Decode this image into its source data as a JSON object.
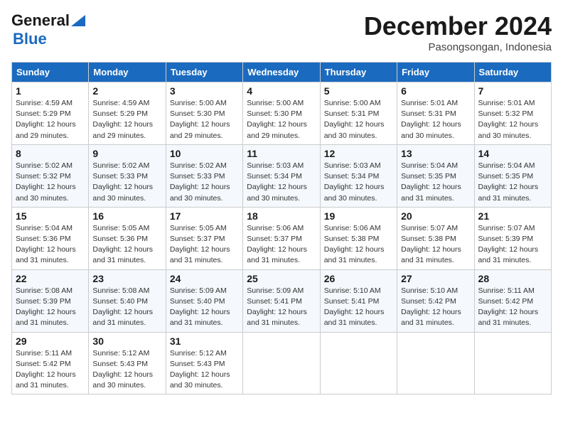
{
  "logo": {
    "text_general": "General",
    "text_blue": "Blue"
  },
  "title": {
    "month_year": "December 2024",
    "location": "Pasongsongan, Indonesia"
  },
  "weekdays": [
    "Sunday",
    "Monday",
    "Tuesday",
    "Wednesday",
    "Thursday",
    "Friday",
    "Saturday"
  ],
  "weeks": [
    [
      {
        "day": "1",
        "info": "Sunrise: 4:59 AM\nSunset: 5:29 PM\nDaylight: 12 hours\nand 29 minutes."
      },
      {
        "day": "2",
        "info": "Sunrise: 4:59 AM\nSunset: 5:29 PM\nDaylight: 12 hours\nand 29 minutes."
      },
      {
        "day": "3",
        "info": "Sunrise: 5:00 AM\nSunset: 5:30 PM\nDaylight: 12 hours\nand 29 minutes."
      },
      {
        "day": "4",
        "info": "Sunrise: 5:00 AM\nSunset: 5:30 PM\nDaylight: 12 hours\nand 29 minutes."
      },
      {
        "day": "5",
        "info": "Sunrise: 5:00 AM\nSunset: 5:31 PM\nDaylight: 12 hours\nand 30 minutes."
      },
      {
        "day": "6",
        "info": "Sunrise: 5:01 AM\nSunset: 5:31 PM\nDaylight: 12 hours\nand 30 minutes."
      },
      {
        "day": "7",
        "info": "Sunrise: 5:01 AM\nSunset: 5:32 PM\nDaylight: 12 hours\nand 30 minutes."
      }
    ],
    [
      {
        "day": "8",
        "info": "Sunrise: 5:02 AM\nSunset: 5:32 PM\nDaylight: 12 hours\nand 30 minutes."
      },
      {
        "day": "9",
        "info": "Sunrise: 5:02 AM\nSunset: 5:33 PM\nDaylight: 12 hours\nand 30 minutes."
      },
      {
        "day": "10",
        "info": "Sunrise: 5:02 AM\nSunset: 5:33 PM\nDaylight: 12 hours\nand 30 minutes."
      },
      {
        "day": "11",
        "info": "Sunrise: 5:03 AM\nSunset: 5:34 PM\nDaylight: 12 hours\nand 30 minutes."
      },
      {
        "day": "12",
        "info": "Sunrise: 5:03 AM\nSunset: 5:34 PM\nDaylight: 12 hours\nand 30 minutes."
      },
      {
        "day": "13",
        "info": "Sunrise: 5:04 AM\nSunset: 5:35 PM\nDaylight: 12 hours\nand 31 minutes."
      },
      {
        "day": "14",
        "info": "Sunrise: 5:04 AM\nSunset: 5:35 PM\nDaylight: 12 hours\nand 31 minutes."
      }
    ],
    [
      {
        "day": "15",
        "info": "Sunrise: 5:04 AM\nSunset: 5:36 PM\nDaylight: 12 hours\nand 31 minutes."
      },
      {
        "day": "16",
        "info": "Sunrise: 5:05 AM\nSunset: 5:36 PM\nDaylight: 12 hours\nand 31 minutes."
      },
      {
        "day": "17",
        "info": "Sunrise: 5:05 AM\nSunset: 5:37 PM\nDaylight: 12 hours\nand 31 minutes."
      },
      {
        "day": "18",
        "info": "Sunrise: 5:06 AM\nSunset: 5:37 PM\nDaylight: 12 hours\nand 31 minutes."
      },
      {
        "day": "19",
        "info": "Sunrise: 5:06 AM\nSunset: 5:38 PM\nDaylight: 12 hours\nand 31 minutes."
      },
      {
        "day": "20",
        "info": "Sunrise: 5:07 AM\nSunset: 5:38 PM\nDaylight: 12 hours\nand 31 minutes."
      },
      {
        "day": "21",
        "info": "Sunrise: 5:07 AM\nSunset: 5:39 PM\nDaylight: 12 hours\nand 31 minutes."
      }
    ],
    [
      {
        "day": "22",
        "info": "Sunrise: 5:08 AM\nSunset: 5:39 PM\nDaylight: 12 hours\nand 31 minutes."
      },
      {
        "day": "23",
        "info": "Sunrise: 5:08 AM\nSunset: 5:40 PM\nDaylight: 12 hours\nand 31 minutes."
      },
      {
        "day": "24",
        "info": "Sunrise: 5:09 AM\nSunset: 5:40 PM\nDaylight: 12 hours\nand 31 minutes."
      },
      {
        "day": "25",
        "info": "Sunrise: 5:09 AM\nSunset: 5:41 PM\nDaylight: 12 hours\nand 31 minutes."
      },
      {
        "day": "26",
        "info": "Sunrise: 5:10 AM\nSunset: 5:41 PM\nDaylight: 12 hours\nand 31 minutes."
      },
      {
        "day": "27",
        "info": "Sunrise: 5:10 AM\nSunset: 5:42 PM\nDaylight: 12 hours\nand 31 minutes."
      },
      {
        "day": "28",
        "info": "Sunrise: 5:11 AM\nSunset: 5:42 PM\nDaylight: 12 hours\nand 31 minutes."
      }
    ],
    [
      {
        "day": "29",
        "info": "Sunrise: 5:11 AM\nSunset: 5:42 PM\nDaylight: 12 hours\nand 31 minutes."
      },
      {
        "day": "30",
        "info": "Sunrise: 5:12 AM\nSunset: 5:43 PM\nDaylight: 12 hours\nand 30 minutes."
      },
      {
        "day": "31",
        "info": "Sunrise: 5:12 AM\nSunset: 5:43 PM\nDaylight: 12 hours\nand 30 minutes."
      },
      {
        "day": "",
        "info": ""
      },
      {
        "day": "",
        "info": ""
      },
      {
        "day": "",
        "info": ""
      },
      {
        "day": "",
        "info": ""
      }
    ]
  ]
}
